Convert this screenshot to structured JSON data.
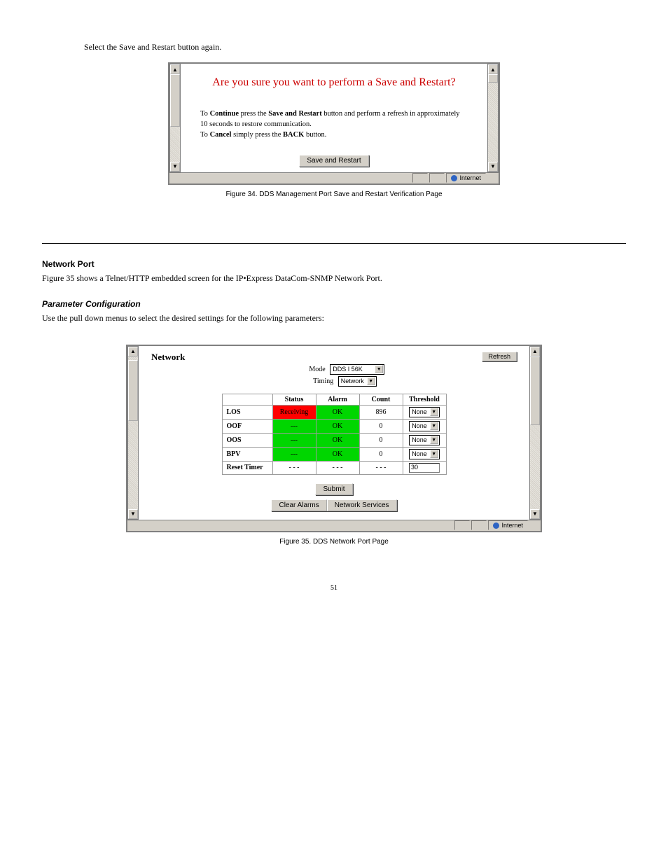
{
  "save_restart_page": {
    "heading_before": "Select the Save and Restart button again.",
    "window": {
      "title": "Are you sure you want to perform a Save and Restart?",
      "instr_html_parts": {
        "p1_pre": "To ",
        "p1_bold1": "Continue",
        "p1_mid1": " press the ",
        "p1_bold2": "Save and Restart",
        "p1_mid2": " button and perform a refresh in approximately 10 seconds to restore communication.",
        "p2_pre": "To ",
        "p2_bold1": "Cancel",
        "p2_mid1": " simply press the ",
        "p2_bold2": "BACK",
        "p2_end": " button."
      },
      "save_button": "Save and Restart",
      "status_internet": "Internet"
    },
    "caption": "Figure 34.  DDS Management Port Save and Restart Verification Page"
  },
  "separator_after": true,
  "network_port_section": {
    "heading": "Network Port",
    "intro": "Figure 35 shows a Telnet/HTTP embedded screen for the IP•Express DataCom-SNMP Network Port.",
    "heading2": "Parameter Configuration",
    "config_intro": "Use the pull down menus to select the desired settings for the following parameters:",
    "window": {
      "title": "Network",
      "refresh": "Refresh",
      "form": {
        "mode_label": "Mode",
        "mode_value": "DDS I 56K",
        "timing_label": "Timing",
        "timing_value": "Network"
      },
      "table": {
        "headers": [
          "",
          "Status",
          "Alarm",
          "Count",
          "Threshold"
        ],
        "rows": [
          {
            "label": "LOS",
            "status": "Receiving",
            "status_class": "red",
            "alarm": "OK",
            "alarm_class": "green",
            "count": "896",
            "threshold": "None"
          },
          {
            "label": "OOF",
            "status": "---",
            "status_class": "green",
            "alarm": "OK",
            "alarm_class": "green",
            "count": "0",
            "threshold": "None"
          },
          {
            "label": "OOS",
            "status": "---",
            "status_class": "green",
            "alarm": "OK",
            "alarm_class": "green",
            "count": "0",
            "threshold": "None"
          },
          {
            "label": "BPV",
            "status": "---",
            "status_class": "green",
            "alarm": "OK",
            "alarm_class": "green",
            "count": "0",
            "threshold": "None"
          },
          {
            "label": "Reset Timer",
            "status": "- - -",
            "status_class": "",
            "alarm": "- - -",
            "alarm_class": "",
            "count": "- - -",
            "threshold_input": "30"
          }
        ]
      },
      "submit": "Submit",
      "clear_alarms": "Clear Alarms",
      "network_services": "Network Services",
      "status_internet": "Internet"
    },
    "caption": "Figure 35.  DDS Network Port Page"
  },
  "footer": {
    "page_no": "51"
  }
}
